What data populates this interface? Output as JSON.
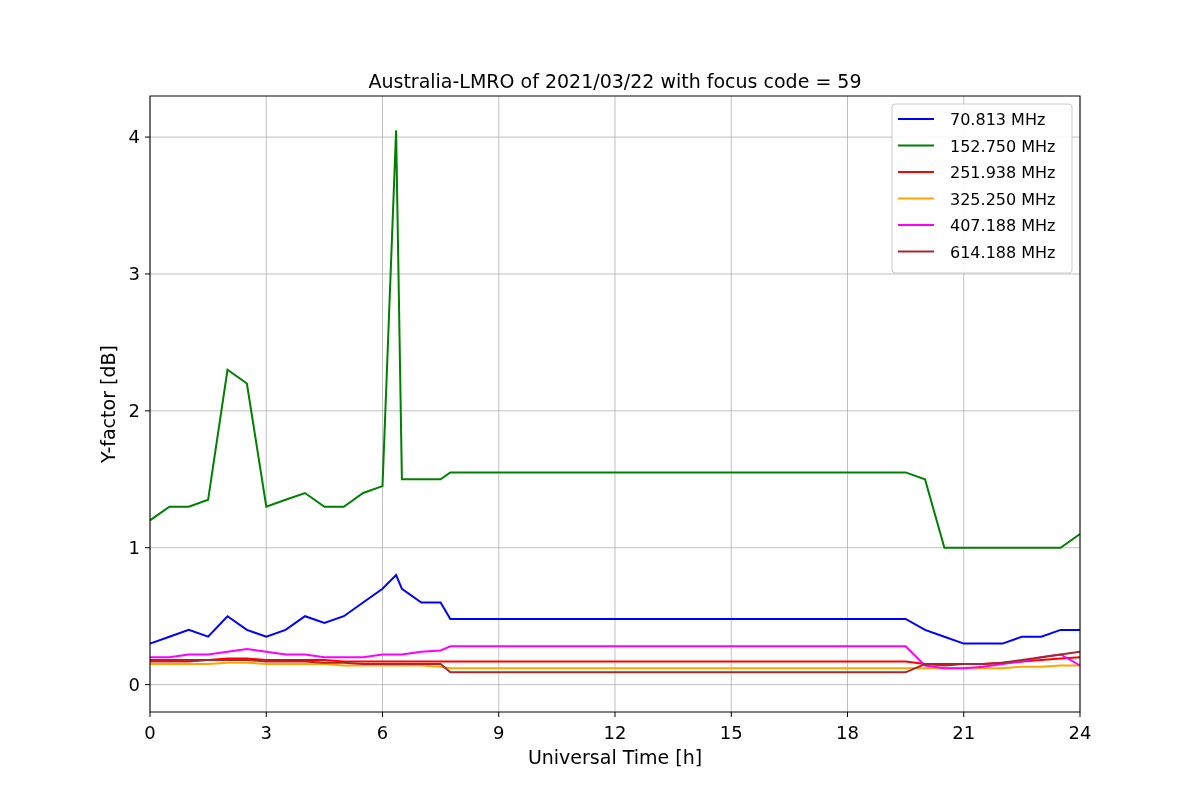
{
  "figure": {
    "chart_data": {
      "type": "line",
      "title": "Australia-LMRO of 2021/03/22 with focus code = 59",
      "xlabel": "Universal Time [h]",
      "ylabel": "Y-factor [dB]",
      "x": [
        0,
        0.5,
        1,
        1.5,
        2,
        2.5,
        3,
        3.5,
        4,
        4.5,
        5,
        5.5,
        6,
        6.35,
        6.5,
        7,
        7.5,
        7.75,
        19.5,
        20,
        20.5,
        21,
        21.5,
        22,
        22.5,
        23,
        23.5,
        24
      ],
      "series": [
        {
          "name": "70.813 MHz",
          "color": "#0000ff",
          "values": [
            0.3,
            0.35,
            0.4,
            0.35,
            0.5,
            0.4,
            0.35,
            0.4,
            0.5,
            0.45,
            0.5,
            0.6,
            0.7,
            0.8,
            0.7,
            0.6,
            0.6,
            0.48,
            0.48,
            0.4,
            0.35,
            0.3,
            0.3,
            0.3,
            0.35,
            0.35,
            0.4,
            0.4
          ]
        },
        {
          "name": "152.750 MHz",
          "color": "#008000",
          "values": [
            1.2,
            1.3,
            1.3,
            1.35,
            2.3,
            2.2,
            1.3,
            1.35,
            1.4,
            1.3,
            1.3,
            1.4,
            1.45,
            4.05,
            1.5,
            1.5,
            1.5,
            1.55,
            1.55,
            1.5,
            1.0,
            1.0,
            1.0,
            1.0,
            1.0,
            1.0,
            1.0,
            1.1
          ]
        },
        {
          "name": "251.938 MHz",
          "color": "#ff0000",
          "values": [
            0.18,
            0.18,
            0.18,
            0.18,
            0.19,
            0.19,
            0.18,
            0.18,
            0.18,
            0.18,
            0.17,
            0.17,
            0.17,
            0.17,
            0.17,
            0.17,
            0.17,
            0.17,
            0.17,
            0.15,
            0.15,
            0.15,
            0.15,
            0.16,
            0.17,
            0.18,
            0.19,
            0.2
          ]
        },
        {
          "name": "325.250 MHz",
          "color": "#ffa500",
          "values": [
            0.15,
            0.15,
            0.15,
            0.15,
            0.16,
            0.16,
            0.15,
            0.15,
            0.15,
            0.15,
            0.14,
            0.14,
            0.14,
            0.14,
            0.14,
            0.14,
            0.13,
            0.12,
            0.12,
            0.12,
            0.12,
            0.12,
            0.12,
            0.12,
            0.13,
            0.13,
            0.14,
            0.14
          ]
        },
        {
          "name": "407.188 MHz",
          "color": "#ff00ff",
          "values": [
            0.2,
            0.2,
            0.22,
            0.22,
            0.24,
            0.26,
            0.24,
            0.22,
            0.22,
            0.2,
            0.2,
            0.2,
            0.22,
            0.22,
            0.22,
            0.24,
            0.25,
            0.28,
            0.28,
            0.14,
            0.12,
            0.12,
            0.13,
            0.15,
            0.17,
            0.2,
            0.22,
            0.14
          ]
        },
        {
          "name": "614.188 MHz",
          "color": "#a52a2a",
          "values": [
            0.17,
            0.17,
            0.17,
            0.18,
            0.18,
            0.18,
            0.17,
            0.17,
            0.17,
            0.16,
            0.16,
            0.15,
            0.15,
            0.15,
            0.15,
            0.15,
            0.15,
            0.09,
            0.09,
            0.15,
            0.14,
            0.15,
            0.15,
            0.16,
            0.18,
            0.2,
            0.22,
            0.24
          ]
        }
      ],
      "xlim": [
        0,
        24
      ],
      "ylim": [
        -0.2,
        4.3
      ],
      "xticks": [
        0,
        3,
        6,
        9,
        12,
        15,
        18,
        21,
        24
      ],
      "yticks": [
        0,
        1,
        2,
        3,
        4
      ],
      "grid": true,
      "legend": true
    }
  }
}
